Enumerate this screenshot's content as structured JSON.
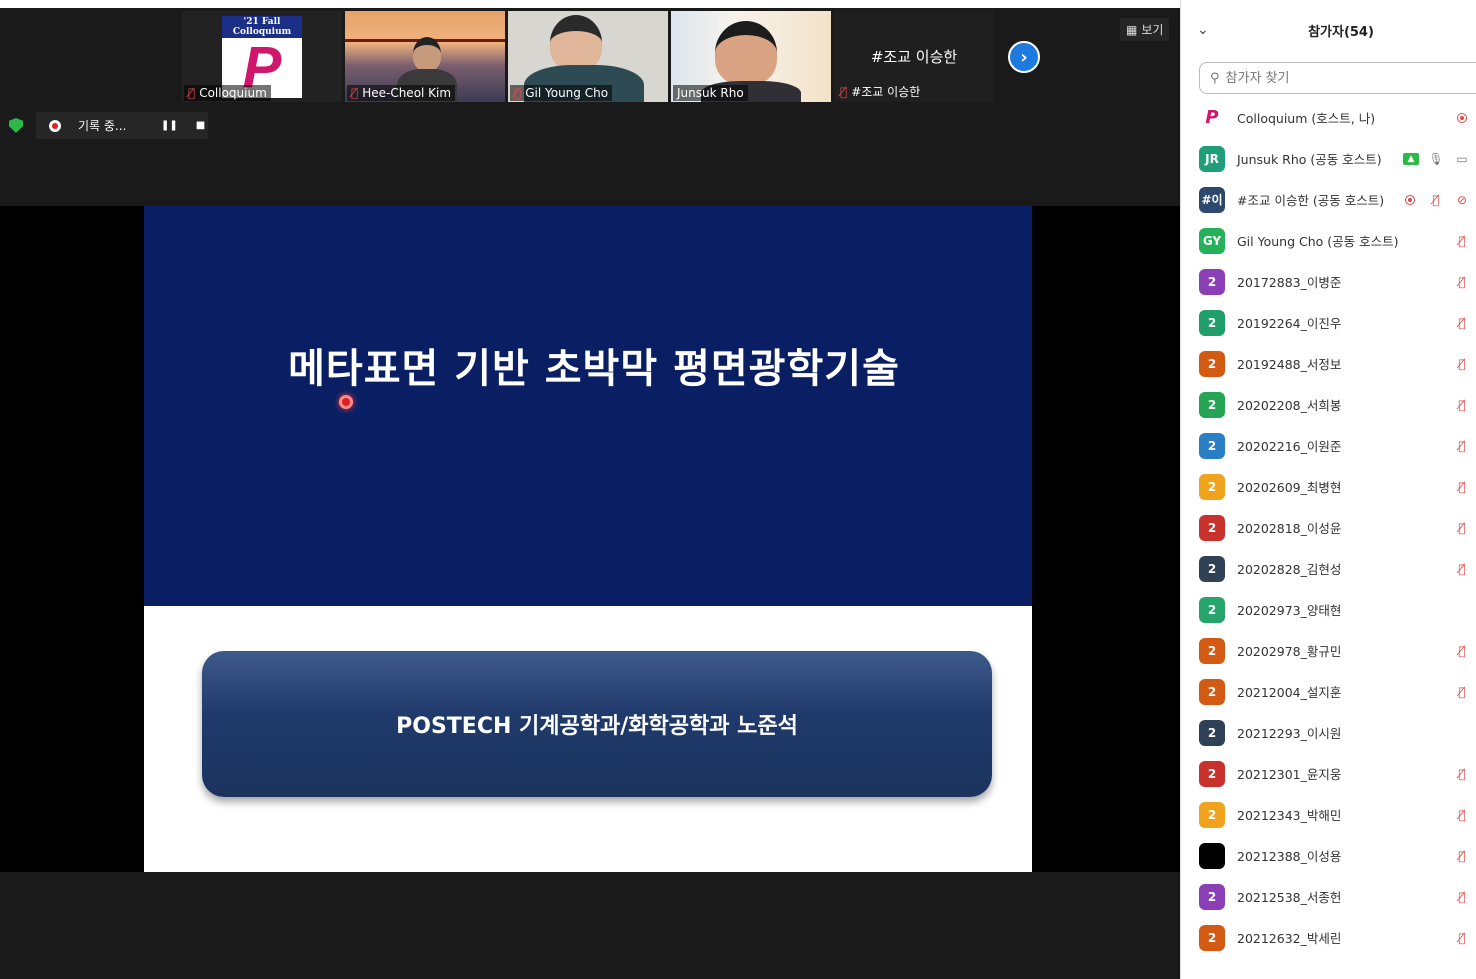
{
  "thumbnails": [
    {
      "name": "Colloquium",
      "logo_top": "'21 Fall Colloquium",
      "logo_letter": "P",
      "active": false
    },
    {
      "name": "Hee-Cheol Kim",
      "active": false
    },
    {
      "name": "Gil Young Cho",
      "active": false
    },
    {
      "name": "Junsuk Rho",
      "active": true
    },
    {
      "name": "#조교 이승한",
      "tile_text": "#조교 이승한",
      "active": false
    }
  ],
  "view_button": {
    "label": "보기"
  },
  "recording": {
    "label": "기록 중...",
    "pause": "❚❚",
    "stop": "■"
  },
  "slide": {
    "title": "메타표면 기반 초박막 평면광학기술",
    "subtitle": "POSTECH 기계공학과/화학공학과 노준석"
  },
  "panel": {
    "title": "참가자(54)",
    "search_placeholder": "참가자 찾기",
    "participants": [
      {
        "avatar": "P",
        "color": "#ffffff",
        "name": "Colloquium (호스트, 나)",
        "icons": [
          "radio",
          "mic-off"
        ]
      },
      {
        "avatar": "JR",
        "color": "#1e9e7a",
        "name": "Junsuk Rho (공동 호스트)",
        "icons": [
          "share",
          "mic",
          "cam"
        ]
      },
      {
        "avatar": "#이",
        "color": "#2d4a6e",
        "name": "#조교 이승한 (공동 호스트)",
        "icons": [
          "radio",
          "mic-off",
          "cam-off"
        ]
      },
      {
        "avatar": "GY",
        "color": "#25b15a",
        "name": "Gil Young Cho (공동 호스트)",
        "icons": [
          "mic-off",
          "cam"
        ]
      },
      {
        "avatar": "2",
        "color": "#8a3fb6",
        "name": "20172883_이병준",
        "icons": [
          "mic-off",
          "cam-off"
        ]
      },
      {
        "avatar": "2",
        "color": "#1f9e6a",
        "name": "20192264_이진우",
        "icons": [
          "mic-off",
          "cam-off"
        ]
      },
      {
        "avatar": "2",
        "color": "#d35a12",
        "name": "20192488_서정보",
        "icons": [
          "mic-off",
          "cam-off"
        ]
      },
      {
        "avatar": "2",
        "color": "#26a456",
        "name": "20202208_서희봉",
        "icons": [
          "mic-off",
          "cam-off"
        ]
      },
      {
        "avatar": "2",
        "color": "#2a7fc4",
        "name": "20202216_이원준",
        "icons": [
          "mic-off",
          "cam-off"
        ]
      },
      {
        "avatar": "2",
        "color": "#f0a31c",
        "name": "20202609_최병현",
        "icons": [
          "mic-off",
          "cam-off"
        ]
      },
      {
        "avatar": "2",
        "color": "#c9322c",
        "name": "20202818_이성윤",
        "icons": [
          "mic-off",
          "cam-off"
        ]
      },
      {
        "avatar": "2",
        "color": "#2f4157",
        "name": "20202828_김현성",
        "icons": [
          "mic-off",
          "cam-off"
        ]
      },
      {
        "avatar": "2",
        "color": "#26a46a",
        "name": "20202973_양태현",
        "icons": [
          "mic-off"
        ]
      },
      {
        "avatar": "2",
        "color": "#d35a12",
        "name": "20202978_황규민",
        "icons": [
          "mic-off",
          "cam-off"
        ]
      },
      {
        "avatar": "2",
        "color": "#d35a12",
        "name": "20212004_설지훈",
        "icons": [
          "mic-off",
          "cam-off"
        ]
      },
      {
        "avatar": "2",
        "color": "#2f4157",
        "name": "20212293_이시원",
        "icons": [
          "mic-off"
        ]
      },
      {
        "avatar": "2",
        "color": "#c9322c",
        "name": "20212301_윤지웅",
        "icons": [
          "mic-off",
          "cam-off"
        ]
      },
      {
        "avatar": "2",
        "color": "#f0a31c",
        "name": "20212343_박해민",
        "icons": [
          "mic-off",
          "cam-off"
        ]
      },
      {
        "avatar": "",
        "color": "#000000",
        "name": "20212388_이성용",
        "icons": [
          "mic-off",
          "cam-off"
        ]
      },
      {
        "avatar": "2",
        "color": "#8a3fb6",
        "name": "20212538_서종헌",
        "icons": [
          "mic-off",
          "cam-off"
        ]
      },
      {
        "avatar": "2",
        "color": "#d35a12",
        "name": "20212632_박세린",
        "icons": [
          "mic-off",
          "cam-off"
        ]
      }
    ]
  },
  "colors": {
    "slide_blue": "#0a1f63",
    "accent_blue": "#1f7ae0",
    "mute_red": "#e04848"
  }
}
